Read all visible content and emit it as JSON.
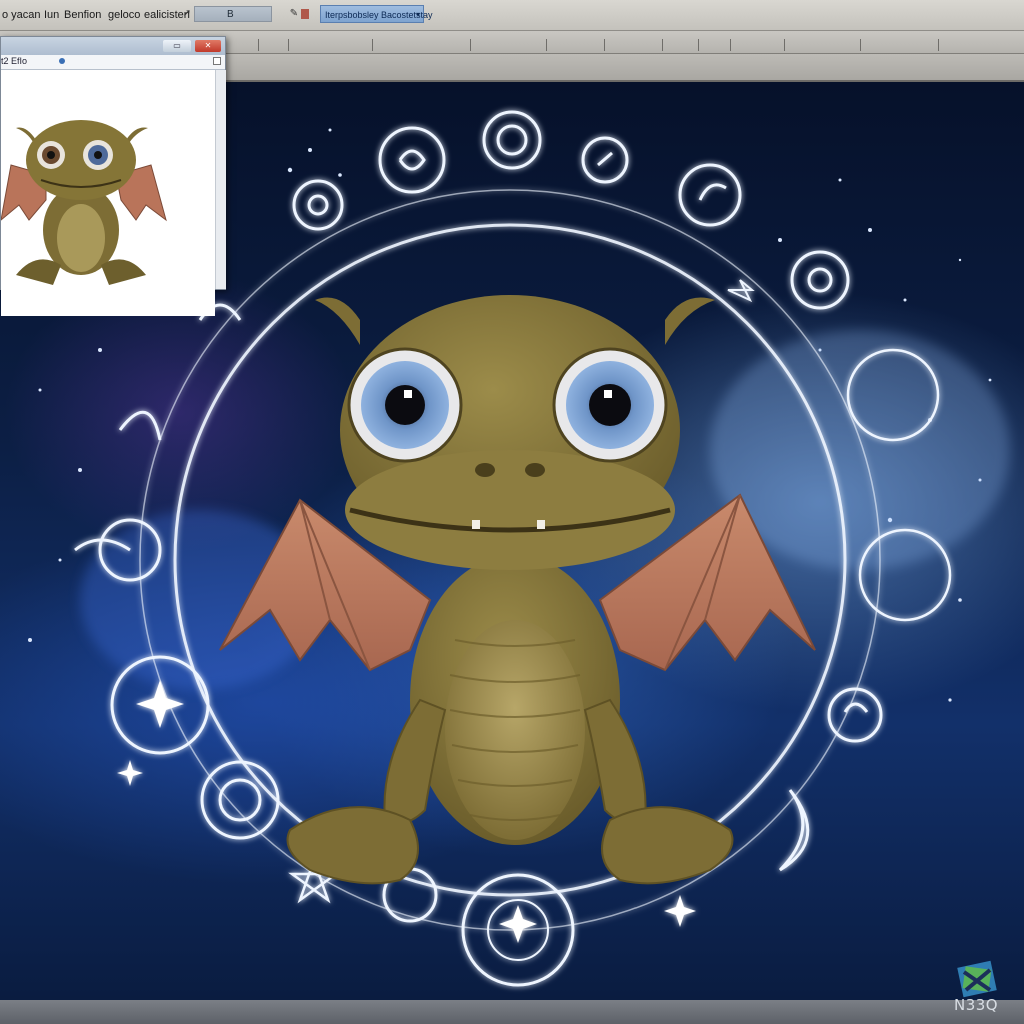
{
  "menubar": {
    "items": [
      "o yacan",
      "Iun",
      "Benfion",
      "geloco",
      "ealicisten"
    ],
    "field_value": "B",
    "combo_label": "Iterpsbobsley  Bacostetstay"
  },
  "preview_window": {
    "address_text": "t2 EfIo"
  },
  "watermark": {
    "text": "N33Q"
  },
  "colors": {
    "space_dark": "#06112a",
    "nebula_blue": "#3a78d8",
    "glow": "#e8f2ff",
    "dragon_skin": "#8a7a3c",
    "wing": "#b9745a"
  }
}
